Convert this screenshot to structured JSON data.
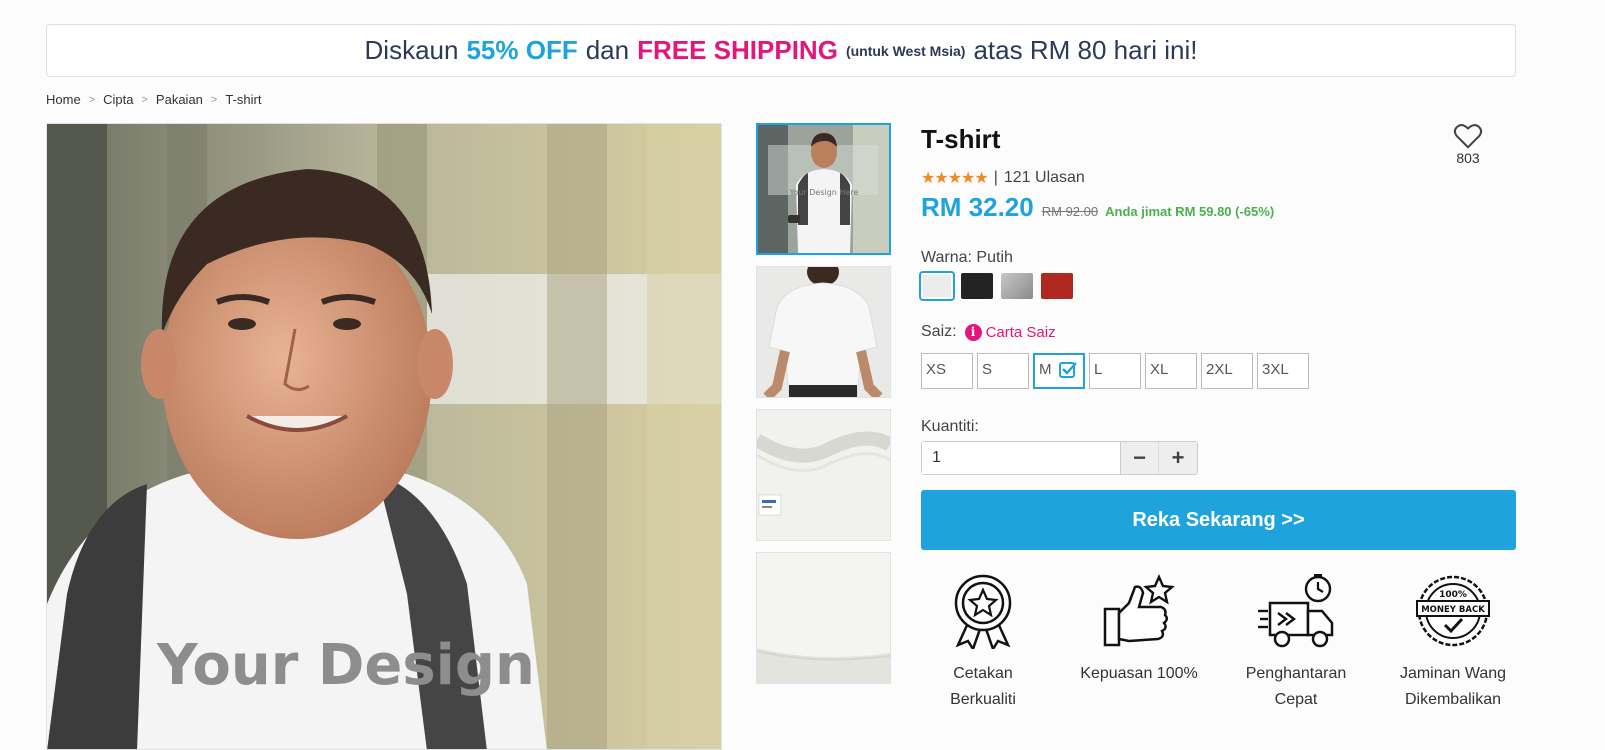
{
  "banner": {
    "text1": "Diskaun",
    "highlight1": "55% OFF",
    "text2": "dan",
    "highlight2": "FREE SHIPPING",
    "note": "(untuk West Msia)",
    "text3": "atas RM 80 hari ini!"
  },
  "breadcrumb": [
    "Home",
    "Cipta",
    "Pakaian",
    "T-shirt"
  ],
  "breadcrumb_sep": ">",
  "thumbnails": [
    {
      "icon": "model-front-photo"
    },
    {
      "icon": "shirt-back-photo"
    },
    {
      "icon": "collar-closeup-photo"
    },
    {
      "icon": "fabric-closeup-photo"
    }
  ],
  "thumbnail_text": "Your Design Here",
  "main_photo_text": "Your Design",
  "product": {
    "title": "T-shirt",
    "favorites": "803",
    "stars": "★★★★★",
    "rating_sep": "|",
    "reviews": "121 Ulasan",
    "price": "RM 32.20",
    "old_price": "RM 92.00",
    "savings": "Anda jimat RM 59.80 (-65%)"
  },
  "color": {
    "label": "Warna: Putih",
    "swatches": [
      "#ececec",
      "#232323",
      "#9a9a9a",
      "#b0281f"
    ],
    "selected_index": 0
  },
  "size": {
    "label": "Saiz:",
    "chart_icon": "i",
    "chart_link": "Carta Saiz",
    "options": [
      "XS",
      "S",
      "M",
      "L",
      "XL",
      "2XL",
      "3XL"
    ],
    "selected": "M"
  },
  "quantity": {
    "label": "Kuantiti:",
    "value": "1",
    "minus": "−",
    "plus": "+"
  },
  "cta_label": "Reka Sekarang >>",
  "features": [
    {
      "line1": "Cetakan",
      "line2": "Berkualiti",
      "icon": "quality-badge-icon"
    },
    {
      "line1": "Kepuasan 100%",
      "line2": "",
      "icon": "thumbs-up-star-icon"
    },
    {
      "line1": "Penghantaran",
      "line2": "Cepat",
      "icon": "fast-delivery-truck-icon"
    },
    {
      "line1": "Jaminan Wang",
      "line2": "Dikembalikan",
      "icon": "money-back-seal-icon"
    }
  ],
  "money_back_seal": {
    "top": "100%",
    "band": "MONEY BACK"
  },
  "colors": {
    "accent": "#1ea3dc",
    "pink": "#e4157b",
    "save_green": "#4caf50",
    "star": "#f08a24"
  }
}
